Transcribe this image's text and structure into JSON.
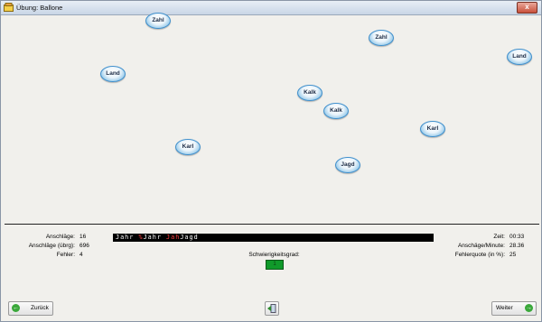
{
  "window": {
    "title": "Übung: Ballone",
    "close_label": "x"
  },
  "balloons": [
    {
      "word": "Zahl"
    },
    {
      "word": "Zahl"
    },
    {
      "word": "Land"
    },
    {
      "word": "Land"
    },
    {
      "word": "Kalk"
    },
    {
      "word": "Kalk"
    },
    {
      "word": "Karl"
    },
    {
      "word": "Karl"
    },
    {
      "word": "Jagd"
    }
  ],
  "stats_left": [
    {
      "label": "Anschläge:",
      "value": "16"
    },
    {
      "label": "Anschläge (übrg):",
      "value": "696"
    },
    {
      "label": "Fehler:",
      "value": "4"
    }
  ],
  "stats_right": [
    {
      "label": "Zeit:",
      "value": "00:33"
    },
    {
      "label": "Anschäge/Minute:",
      "value": "28.36"
    },
    {
      "label": "Fehlerquote (in %):",
      "value": "25"
    }
  ],
  "typed": {
    "part1": "Jahr ",
    "err1": "%",
    "part2": "Jahr ",
    "err2": "Jah",
    "part3": "Jagd"
  },
  "difficulty": {
    "label": "Schwierigkeitsgrad:",
    "value": "1"
  },
  "buttons": {
    "back": "Zurück",
    "next": "Weiter"
  },
  "colors": {
    "error": "#ff4040",
    "difficulty": "#109a2a"
  }
}
